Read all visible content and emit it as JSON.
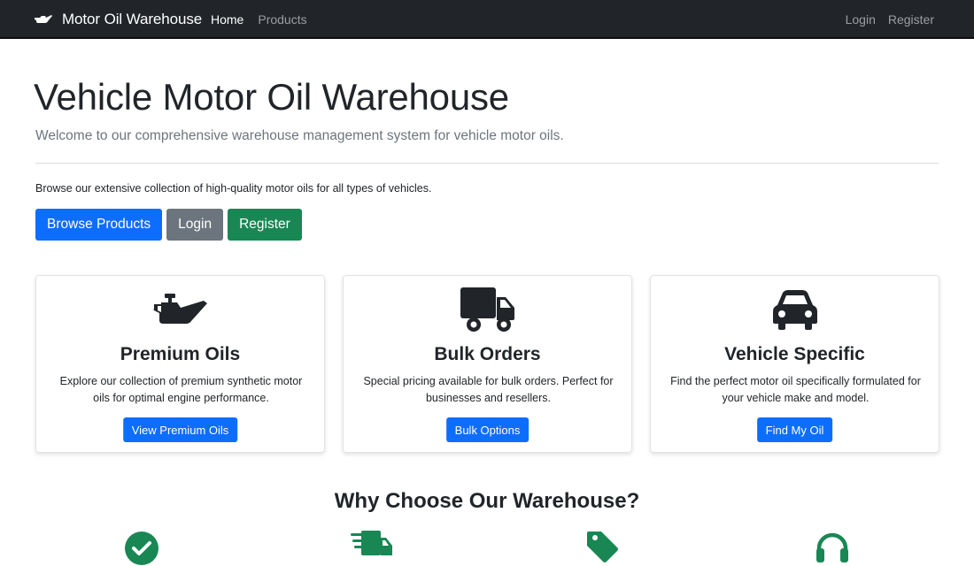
{
  "navbar": {
    "brand": "Motor Oil Warehouse",
    "brand_icon": "oil-can-icon",
    "left_links": [
      {
        "label": "Home",
        "active": true
      },
      {
        "label": "Products",
        "active": false
      }
    ],
    "right_links": [
      {
        "label": "Login"
      },
      {
        "label": "Register"
      }
    ]
  },
  "hero": {
    "title": "Vehicle Motor Oil Warehouse",
    "lead": "Welcome to our comprehensive warehouse management system for vehicle motor oils.",
    "text": "Browse our extensive collection of high-quality motor oils for all types of vehicles.",
    "buttons": {
      "browse": "Browse Products",
      "login": "Login",
      "register": "Register"
    }
  },
  "cards": [
    {
      "icon": "oil-can-icon",
      "title": "Premium Oils",
      "text": "Explore our collection of premium synthetic motor oils for optimal engine performance.",
      "button": "View Premium Oils"
    },
    {
      "icon": "truck-icon",
      "title": "Bulk Orders",
      "text": "Special pricing available for bulk orders. Perfect for businesses and resellers.",
      "button": "Bulk Options"
    },
    {
      "icon": "car-icon",
      "title": "Vehicle Specific",
      "text": "Find the perfect motor oil specifically formulated for your vehicle make and model.",
      "button": "Find My Oil"
    }
  ],
  "why": {
    "title": "Why Choose Our Warehouse?",
    "icons": [
      "check-circle-icon",
      "fast-shipping-icon",
      "tag-icon",
      "headset-icon"
    ]
  },
  "colors": {
    "navbar": "#212529",
    "primary": "#0d6efd",
    "secondary": "#6c757d",
    "success": "#198754",
    "muted": "#6c757d"
  }
}
